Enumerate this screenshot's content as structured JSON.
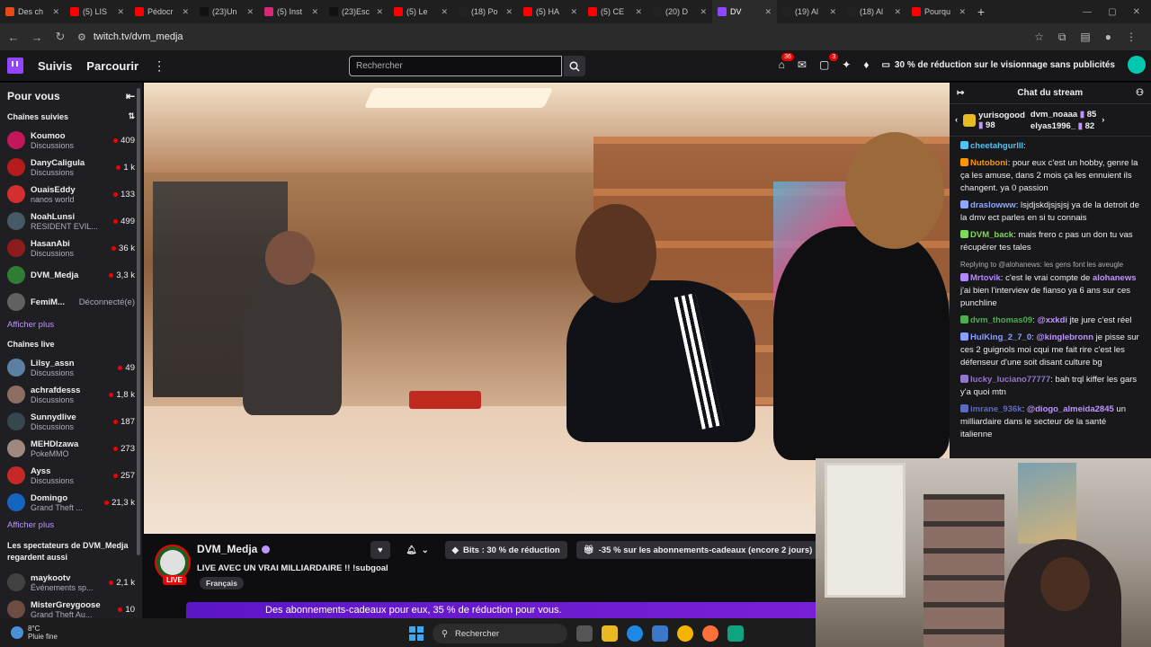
{
  "browser": {
    "tabs": [
      {
        "label": "Des ch",
        "color": "#e64a19",
        "active": false
      },
      {
        "label": "(5) LIS",
        "color": "#ff0000",
        "active": false
      },
      {
        "label": "Pédocr",
        "color": "#ff0000",
        "active": false
      },
      {
        "label": "(23)Un",
        "color": "#111111",
        "active": false
      },
      {
        "label": "(5) Inst",
        "color": "#d62976",
        "active": false
      },
      {
        "label": "(23)Esc",
        "color": "#111111",
        "active": false
      },
      {
        "label": "(5) Le",
        "color": "#ff0000",
        "active": false
      },
      {
        "label": "(18) Po",
        "color": "#222222",
        "active": false
      },
      {
        "label": "(5) HA",
        "color": "#ff0000",
        "active": false
      },
      {
        "label": "(5) CE",
        "color": "#ff0000",
        "active": false
      },
      {
        "label": "(20) D",
        "color": "#222222",
        "active": false
      },
      {
        "label": "DV",
        "color": "#9147ff",
        "active": true
      },
      {
        "label": "(19) Al",
        "color": "#222222",
        "active": false
      },
      {
        "label": "(18) Al",
        "color": "#222222",
        "active": false
      },
      {
        "label": "Pourqu",
        "color": "#ff0000",
        "active": false
      }
    ],
    "url": "twitch.tv/dvm_medja"
  },
  "nav": {
    "following": "Suivis",
    "browse": "Parcourir",
    "search_placeholder": "Rechercher",
    "notif_count_1": "36",
    "notif_count_2": "3",
    "promo": "30 % de réduction sur le visionnage sans publicités"
  },
  "sidebar": {
    "title": "Pour vous",
    "followed_title": "Chaînes suivies",
    "followed": [
      {
        "name": "Koumoo",
        "game": "Discussions",
        "viewers": "409",
        "color": "#c2185b"
      },
      {
        "name": "DanyCaligula",
        "game": "Discussions",
        "viewers": "1 k",
        "color": "#b71c1c"
      },
      {
        "name": "OuaisEddy",
        "game": "nanos world",
        "viewers": "133",
        "color": "#d32f2f"
      },
      {
        "name": "NoahLunsi",
        "game": "RESIDENT EVIL...",
        "viewers": "499",
        "color": "#455a64"
      },
      {
        "name": "HasanAbi",
        "game": "Discussions",
        "viewers": "36 k",
        "color": "#8d1c1c"
      },
      {
        "name": "DVM_Medja",
        "game": "",
        "viewers": "3,3 k",
        "color": "#2e7d32"
      },
      {
        "name": "FemiM...",
        "game": "",
        "viewers": "",
        "offline": "Déconnecté(e)",
        "color": "#616161"
      }
    ],
    "show_more": "Afficher plus",
    "live_title": "Chaînes live",
    "live": [
      {
        "name": "Lilsy_assn",
        "game": "Discussions",
        "viewers": "49",
        "color": "#5d7fa3"
      },
      {
        "name": "achrafdesss",
        "game": "Discussions",
        "viewers": "1,8 k",
        "color": "#8d6e63"
      },
      {
        "name": "Sunnydlive",
        "game": "Discussions",
        "viewers": "187",
        "color": "#37474f"
      },
      {
        "name": "MEHDIzawa",
        "game": "PokeMMO",
        "viewers": "273",
        "color": "#a1887f"
      },
      {
        "name": "Ayss",
        "game": "Discussions",
        "viewers": "257",
        "color": "#c62828"
      },
      {
        "name": "Domingo",
        "game": "Grand Theft ...",
        "viewers": "21,3 k",
        "color": "#1565c0"
      }
    ],
    "show_more_2": "Afficher plus",
    "also_title": "Les spectateurs de DVM_Medja regardent aussi",
    "also": [
      {
        "name": "maykootv",
        "game": "Événements sp...",
        "viewers": "2,1 k",
        "color": "#424242"
      },
      {
        "name": "MisterGreygoose",
        "game": "Grand Theft Au...",
        "viewers": "10",
        "color": "#6d4c41"
      }
    ]
  },
  "stream": {
    "channel": "DVM_Medja",
    "live_label": "LIVE",
    "title": "LIVE AVEC UN VRAI MILLIARDAIRE !! !subgoal",
    "language": "Français",
    "bits_label": "Bits : 30 % de réduction",
    "gift_label": "-35 % sur les abonnements-cadeaux (encore 2 jours)",
    "banner": "Des abonnements-cadeaux pour eux, 35 % de réduction pour vous."
  },
  "chat": {
    "title": "Chat du stream",
    "gifters": [
      {
        "name": "yurisogood",
        "count": "98"
      },
      {
        "name": "dvm_noaaa",
        "count": "85"
      },
      {
        "name": "elyas1996_",
        "count": "82"
      }
    ],
    "messages": [
      {
        "user": "cheetahgurlll",
        "color": "#4fc3f7",
        "text": ""
      },
      {
        "user": "Nutoboni",
        "color": "#ff9800",
        "text": "pour eux c'est un hobby, genre la ça les amuse, dans 2 mois ça les ennuient ils changent. ya 0 passion"
      },
      {
        "user": "draslowww",
        "color": "#8fa8ff",
        "text": "lsjdjskdjsjsjsj ya de la detroit de la dmv ect parles en si tu connais"
      },
      {
        "user": "DVM_back",
        "color": "#7ed957",
        "text": "mais frero c pas un don tu vas récupérer tes tales"
      },
      {
        "reply": "Replying to @alohanews: les gens font les aveugle",
        "user": "Mrtovik",
        "color": "#b388ff",
        "text": "c'est le vrai compte de",
        "mention": "alohanews",
        "after": "j'ai bien l'interview de fianso ya 6 ans sur ces punchline"
      },
      {
        "user": "dvm_thomas09",
        "color": "#4caf50",
        "text": "",
        "mention": "@xxkdi",
        "after": "jte jure c'est réel"
      },
      {
        "user": "HulKing_2_7_0",
        "color": "#8c9eff",
        "text": "",
        "mention": "@kinglebronn",
        "after": "je pisse sur ces 2 guignols moi cqui me fait rire c'est les défenseur d'une soit disant culture bg"
      },
      {
        "user": "lucky_luciano77777",
        "color": "#9575cd",
        "text": "bah trql kiffer les gars y'a quoi mtn"
      },
      {
        "user": "imrane_936k",
        "color": "#5c6bc0",
        "text": "",
        "mention": "@diogo_almeida2845",
        "after": "un milliardaire dans le secteur de la santé italienne"
      }
    ]
  },
  "taskbar": {
    "temp": "8°C",
    "weather": "Pluie fine",
    "search": "Rechercher"
  }
}
